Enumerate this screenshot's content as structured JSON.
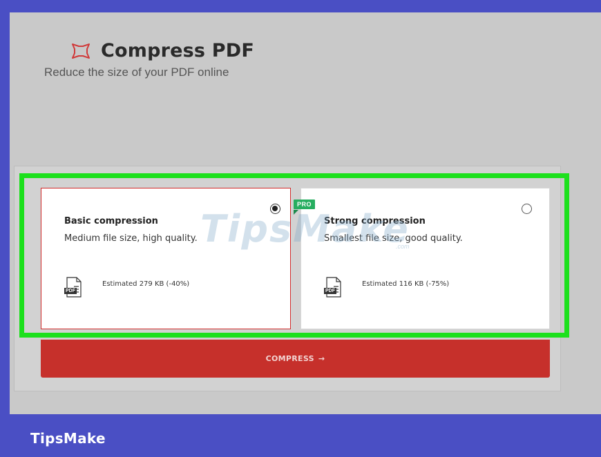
{
  "header": {
    "title": "Compress PDF",
    "subtitle": "Reduce the size of your PDF online",
    "logo_icon": "compress-icon"
  },
  "options": [
    {
      "title": "Basic compression",
      "description": "Medium file size, high quality.",
      "estimate": "Estimated 279 KB (-40%)",
      "selected": true
    },
    {
      "title": "Strong compression",
      "description": "Smallest file size, good quality.",
      "estimate": "Estimated 116 KB (-75%)",
      "badge": "PRO",
      "selected": false
    }
  ],
  "pdf_tag": "PDF",
  "compress_button": {
    "label": "COMPRESS",
    "arrow": "→"
  },
  "watermark": {
    "text": "TipsMake",
    "sub": ".com"
  },
  "brand": "TipsMake",
  "colors": {
    "accent_red": "#c6302b",
    "highlight_green": "#1ce01c",
    "pro_green": "#27ae60",
    "frame_blue": "#4a4fc4"
  }
}
